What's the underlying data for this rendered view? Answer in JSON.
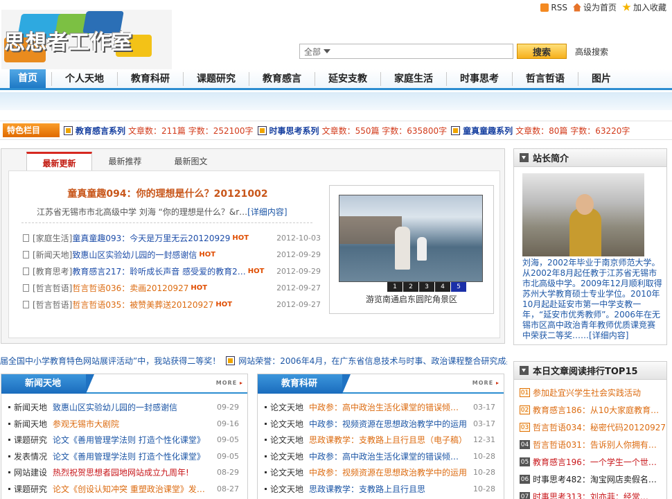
{
  "toplinks": {
    "rss": "RSS",
    "home": "设为首页",
    "fav": "加入收藏"
  },
  "logo": {
    "text": "思想者工作室"
  },
  "search": {
    "scope": "全部",
    "button": "搜索",
    "advanced": "高级搜索"
  },
  "nav": [
    "首页",
    "个人天地",
    "教育科研",
    "课题研究",
    "教育感言",
    "延安支教",
    "家庭生活",
    "时事思考",
    "哲言哲语",
    "图片"
  ],
  "featured": {
    "label": "特色栏目",
    "items": [
      {
        "name": "教育感言系列",
        "count": "文章数：211篇 字数：252100字"
      },
      {
        "name": "时事思考系列",
        "count": "文章数：550篇 字数：635800字"
      },
      {
        "name": "童真童趣系列",
        "count": "文章数：80篇 字数：63220字"
      }
    ]
  },
  "main": {
    "tabs": [
      "最新更新",
      "最新推荐",
      "最新图文"
    ],
    "headline": "童真童趣094：你的理想是什么？20121002",
    "desc": "江苏省无锡市市北高级中学  刘海  “你的理想是什么？&r…",
    "desc_more": "[详细内容]",
    "news": [
      {
        "cat": "[家庭生活]",
        "title": "童真童趣093：今天是万里无云20120929",
        "date": "2012-10-03",
        "style": "blue"
      },
      {
        "cat": "[新闻天地]",
        "title": "致惠山区实验幼儿园的一封感谢信",
        "date": "2012-09-29",
        "style": "blue"
      },
      {
        "cat": "[教育思考]",
        "title": "教育感言217：聆听成长声音  感受爱的教育2…",
        "date": "2012-09-29",
        "style": "blue"
      },
      {
        "cat": "[哲言哲语]",
        "title": "哲言哲语036：卖画20120927",
        "date": "2012-09-27",
        "style": "org"
      },
      {
        "cat": "[哲言哲语]",
        "title": "哲言哲语035：被赞美葬送20120927",
        "date": "2012-09-27",
        "style": "org"
      }
    ],
    "hot": "HOT",
    "photo_caption": "游览南通启东圆陀角景区",
    "photo_pages": [
      "1",
      "2",
      "3",
      "4",
      "5"
    ]
  },
  "ticker": {
    "a": "届全国中小学教育特色网站展评活动”中，我站获得二等奖！",
    "b": "网站荣誉：2006年4月，在广东省信息技术与时事、政治课程整合研究成果"
  },
  "profile": {
    "title": "站长简介",
    "text": "刘海，2002年毕业于南京师范大学。从2002年8月起任教于江苏省无锡市市北高级中学。2009年12月顺利取得苏州大学教育硕士专业学位。2010年10月起赴延安市第一中学支教一年，“延安市优秀教师”。2006年在无锡市区高中政治青年教师优质课竞赛中荣获二等奖……",
    "more": "[详细内容]"
  },
  "rank": {
    "title": "本日文章阅读排行TOP15",
    "items": [
      {
        "n": "01",
        "title": "参加赴宜兴学生社会实践活动",
        "style": "org"
      },
      {
        "n": "02",
        "title": "教育感言186：从10大家庭教育…",
        "style": "org"
      },
      {
        "n": "03",
        "title": "哲言哲语034：秘密代码20120927",
        "style": "org"
      },
      {
        "n": "04",
        "title": "哲言哲语031：告诉别人你拥有…",
        "style": "org"
      },
      {
        "n": "05",
        "title": "教育感言196：一个学生一个世…",
        "style": "red"
      },
      {
        "n": "06",
        "title": "时事思考482：淘宝网店卖假名…",
        "style": "blk"
      },
      {
        "n": "07",
        "title": "时事思考313：刘亦菲：经常…",
        "style": "red"
      }
    ]
  },
  "news_box": {
    "title": "新闻天地",
    "more": "MORE",
    "items": [
      {
        "cat": "新闻天地",
        "title": "致惠山区实验幼儿园的一封感谢信",
        "date": "09-29",
        "style": "blue"
      },
      {
        "cat": "新闻天地",
        "title": "参观无锡市大剧院",
        "date": "09-16",
        "style": "org"
      },
      {
        "cat": "课题研究",
        "title": "论文《善用管理学法则  打造个性化课堂》",
        "date": "09-05",
        "style": "blue"
      },
      {
        "cat": "发表情况",
        "title": "论文《善用管理学法则  打造个性化课堂》",
        "date": "09-05",
        "style": "blue"
      },
      {
        "cat": "网站建设",
        "title": "热烈祝贺思想者园地网站成立九周年!",
        "date": "08-29",
        "style": "red"
      },
      {
        "cat": "课题研究",
        "title": "论文《创设认知冲突  重塑政治课堂》发表…",
        "date": "08-27",
        "style": "org"
      }
    ]
  },
  "research_box": {
    "title": "教育科研",
    "more": "MORE",
    "items": [
      {
        "cat": "论文天地",
        "title": "中政参：高中政治生活化课堂的错误倾向及…",
        "date": "03-17",
        "style": "org"
      },
      {
        "cat": "论文天地",
        "title": "中政参：视频资源在思想政治教学中的运用",
        "date": "03-17",
        "style": "blue"
      },
      {
        "cat": "论文天地",
        "title": "思政课教学：支教路上且行且思（电子稿）",
        "date": "12-31",
        "style": "org"
      },
      {
        "cat": "论文天地",
        "title": "中政参：高中政治生活化课堂的错误倾向及…",
        "date": "10-28",
        "style": "blue"
      },
      {
        "cat": "论文天地",
        "title": "中政参：视频资源在思想政治教学中的运用",
        "date": "10-28",
        "style": "org"
      },
      {
        "cat": "论文天地",
        "title": "思政课教学：支教路上且行且思",
        "date": "10-28",
        "style": "blue"
      }
    ]
  }
}
